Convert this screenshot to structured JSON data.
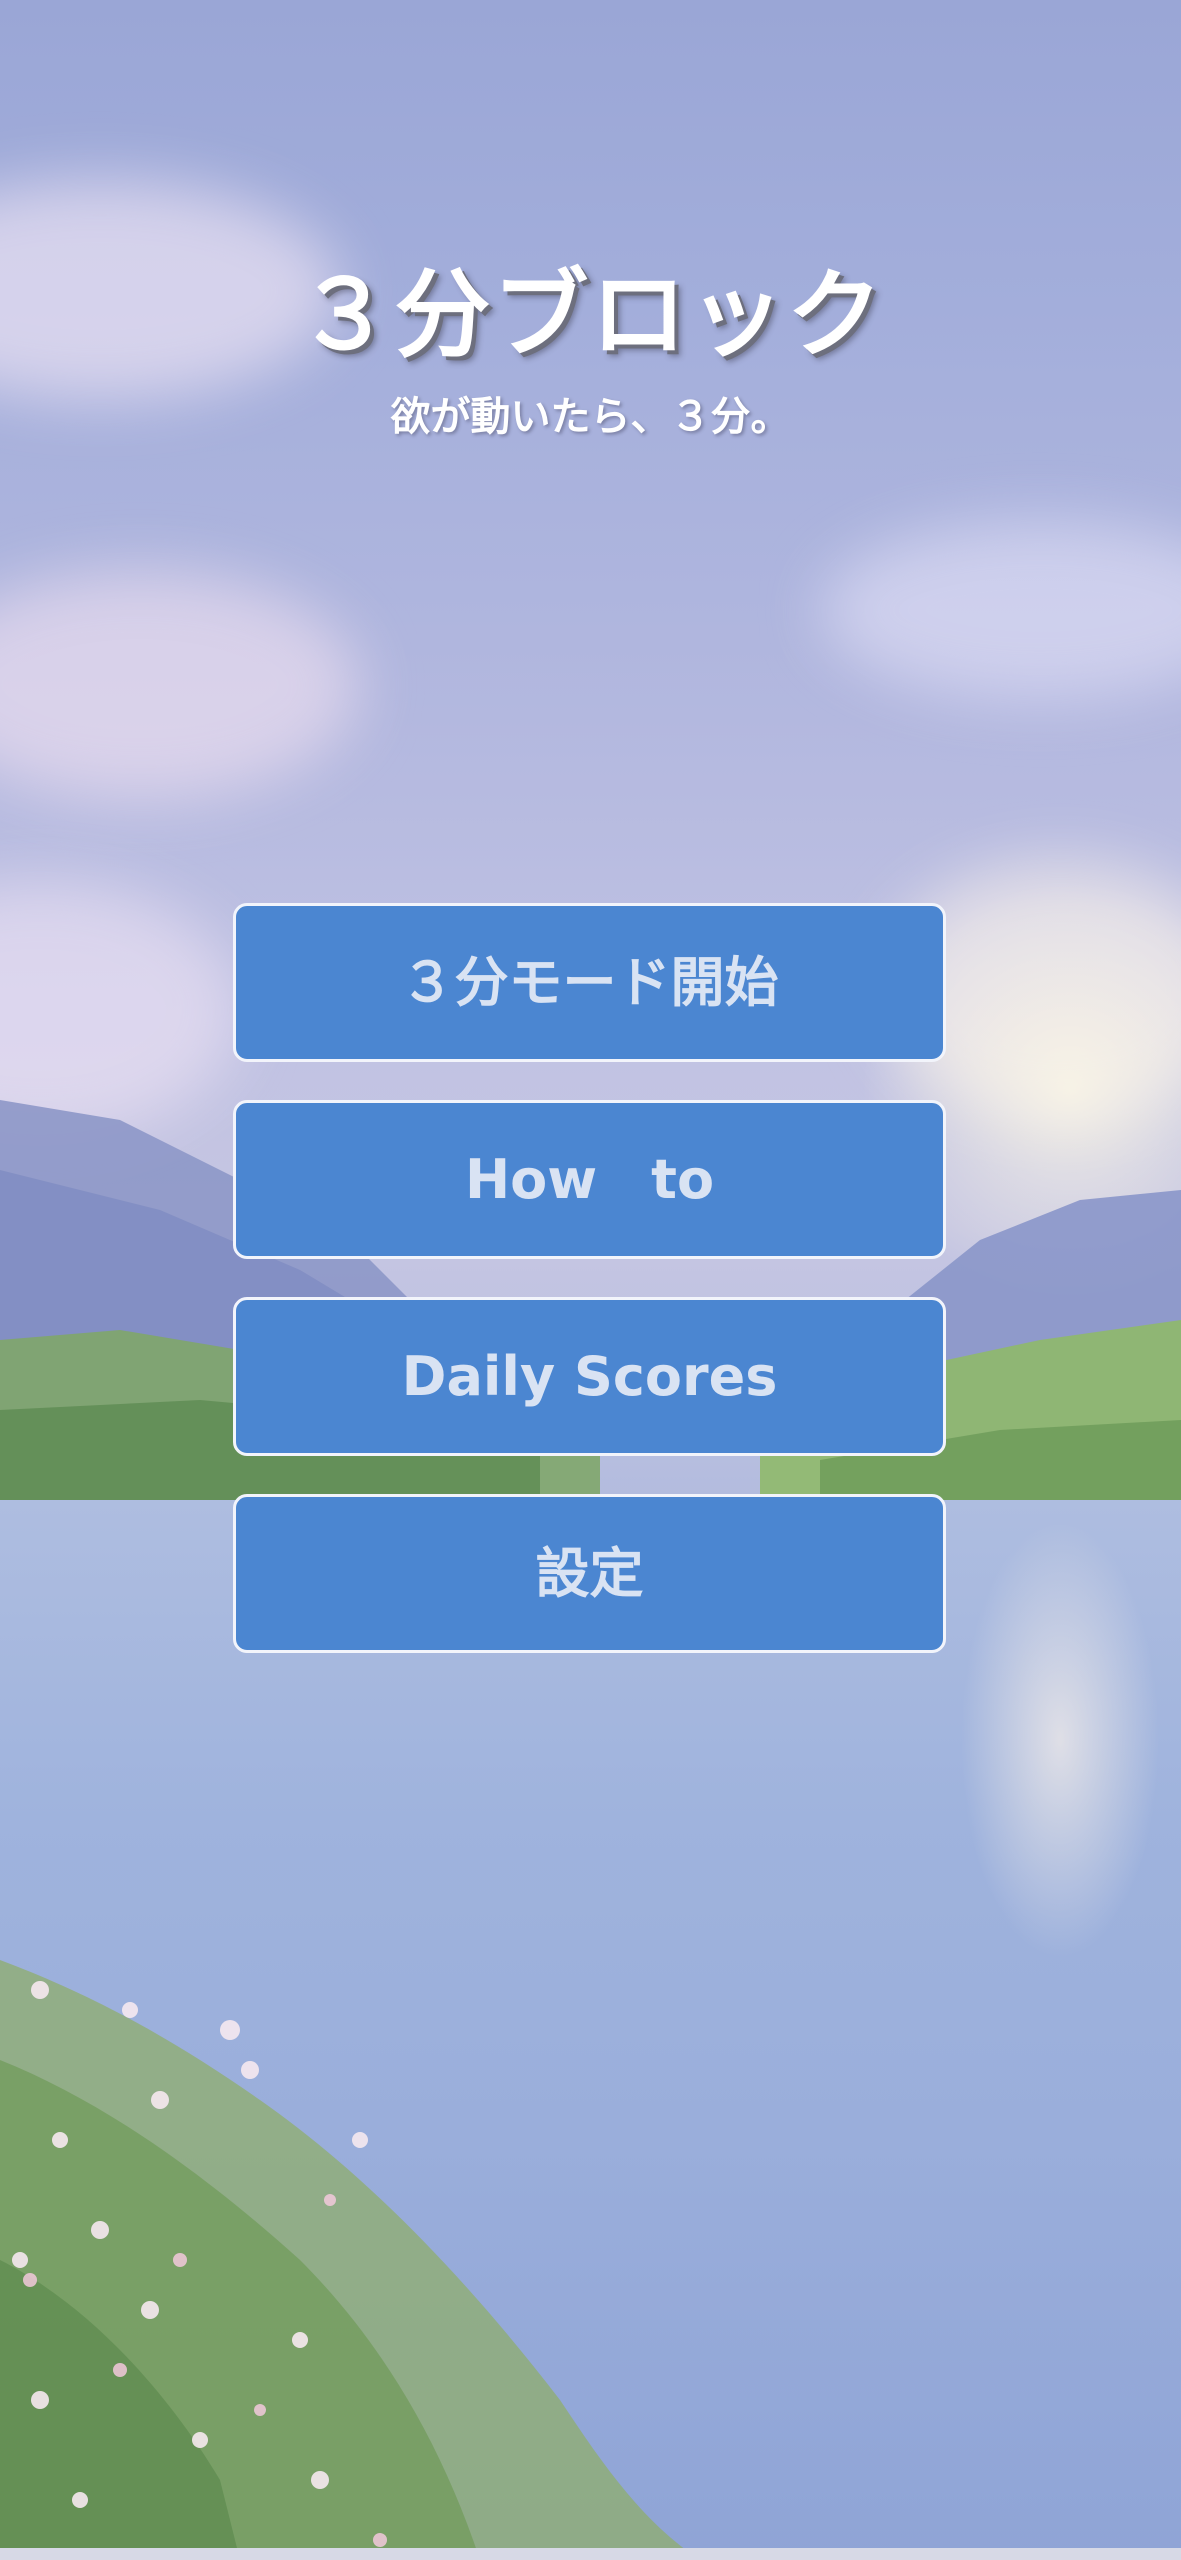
{
  "app": {
    "title": "３分ブロック",
    "subtitle": "欲が動いたら、３分。"
  },
  "menu": {
    "buttons": [
      {
        "id": "start",
        "label": "３分モード開始"
      },
      {
        "id": "howto",
        "label": "How　to"
      },
      {
        "id": "scores",
        "label": "Daily Scores"
      },
      {
        "id": "settings",
        "label": "設定"
      }
    ]
  },
  "colors": {
    "button_fill": "#4b86d1",
    "button_border": "#f2f4fb",
    "button_text": "#d9e3f3",
    "title_text": "#ffffff"
  },
  "background": {
    "scene": "lake-with-mountains-and-flowers"
  }
}
